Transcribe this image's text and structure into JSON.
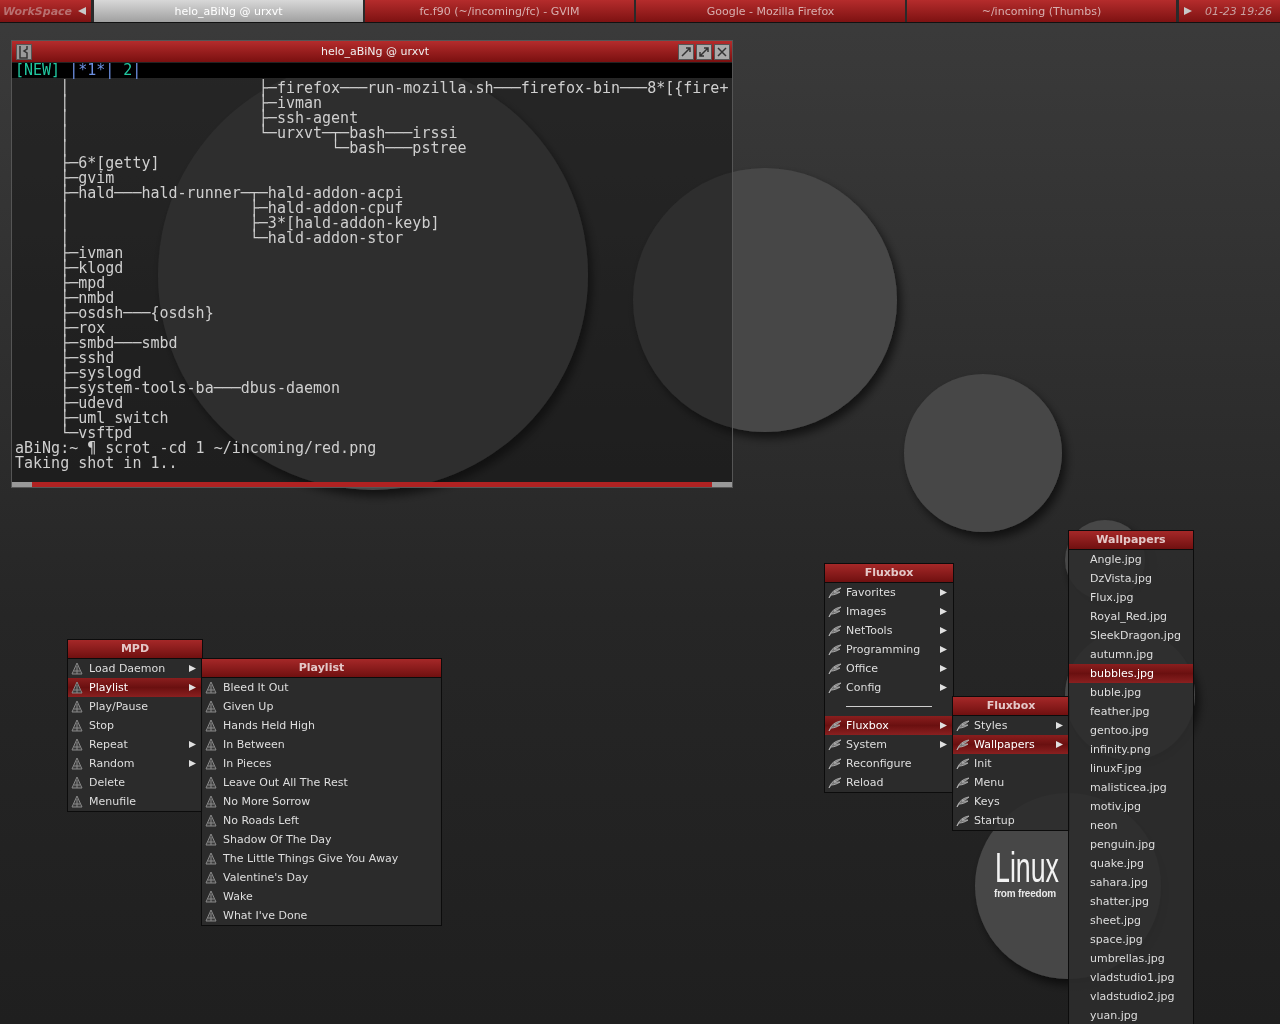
{
  "taskbar": {
    "items": [
      {
        "kind": "workspace",
        "label": "WorkSpace"
      },
      {
        "kind": "prev"
      },
      {
        "kind": "task",
        "label": "helo_aBiNg @ urxvt",
        "selected": true
      },
      {
        "kind": "task",
        "label": "fc.f90 (~/incoming/fc) - GVIM",
        "selected": false
      },
      {
        "kind": "task",
        "label": "Google - Mozilla Firefox",
        "selected": false
      },
      {
        "kind": "task",
        "label": "~/incoming (Thumbs)",
        "selected": false
      },
      {
        "kind": "next"
      },
      {
        "kind": "clock",
        "label": "01-23 19:26"
      }
    ]
  },
  "wallpaper_logo": {
    "word": "Linux",
    "tagline": "from freedom"
  },
  "terminal": {
    "title": "helo_aBiNg @ urxvt",
    "tabs": [
      {
        "kind": "new",
        "label": "[NEW]"
      },
      {
        "kind": "tab",
        "label": "|*1*|",
        "selected": true
      },
      {
        "kind": "tab",
        "label": "2",
        "selected": false
      },
      {
        "kind": "separator",
        "label": "|"
      }
    ],
    "lines": [
      "     │                     ├─firefox───run-mozilla.sh───firefox-bin───8*[{fire+",
      "     │                     ├─ivman",
      "     │                     ├─ssh-agent",
      "     │                     └─urxvt─┬─bash───irssi",
      "     │                             └─bash───pstree",
      "     ├─6*[getty]",
      "     ├─gvim",
      "     ├─hald───hald-runner─┬─hald-addon-acpi",
      "     │                    ├─hald-addon-cpuf",
      "     │                    ├─3*[hald-addon-keyb]",
      "     │                    └─hald-addon-stor",
      "     ├─ivman",
      "     ├─klogd",
      "     ├─mpd",
      "     ├─nmbd",
      "     ├─osdsh───{osdsh}",
      "     ├─rox",
      "     ├─smbd───smbd",
      "     ├─sshd",
      "     ├─syslogd",
      "     ├─system-tools-ba───dbus-daemon",
      "     ├─udevd",
      "     ├─uml_switch",
      "     └─vsftpd",
      "aBiNg:~ ¶ scrot -cd 1 ~/incoming/red.png",
      "Taking shot in 1.."
    ]
  },
  "menus": [
    {
      "kind": "mpd",
      "title": "MPD",
      "items": [
        {
          "label": "Load Daemon",
          "selected": false,
          "submenu": true
        },
        {
          "label": "Playlist",
          "selected": true,
          "submenu": true
        },
        {
          "label": "Play/Pause",
          "selected": false,
          "submenu": false
        },
        {
          "label": "Stop",
          "selected": false,
          "submenu": false
        },
        {
          "label": "Repeat",
          "selected": false,
          "submenu": true
        },
        {
          "label": "Random",
          "selected": false,
          "submenu": true
        },
        {
          "label": "Delete",
          "selected": false,
          "submenu": false
        },
        {
          "label": "Menufile",
          "selected": false,
          "submenu": false
        }
      ]
    },
    {
      "kind": "mpd",
      "title": "Playlist",
      "items": [
        {
          "label": "Bleed It Out",
          "selected": false,
          "submenu": false
        },
        {
          "label": "Given Up",
          "selected": false,
          "submenu": false
        },
        {
          "label": "Hands Held High",
          "selected": false,
          "submenu": false
        },
        {
          "label": "In Between",
          "selected": false,
          "submenu": false
        },
        {
          "label": "In Pieces",
          "selected": false,
          "submenu": false
        },
        {
          "label": "Leave Out All The Rest",
          "selected": false,
          "submenu": false
        },
        {
          "label": "No More Sorrow",
          "selected": false,
          "submenu": false
        },
        {
          "label": "No Roads Left",
          "selected": false,
          "submenu": false
        },
        {
          "label": "Shadow Of The Day",
          "selected": false,
          "submenu": false
        },
        {
          "label": "The Little Things Give You Away",
          "selected": false,
          "submenu": false
        },
        {
          "label": "Valentine's Day",
          "selected": false,
          "submenu": false
        },
        {
          "label": "Wake",
          "selected": false,
          "submenu": false
        },
        {
          "label": "What I've Done",
          "selected": false,
          "submenu": false
        }
      ]
    },
    {
      "kind": "fluxbox",
      "title": "Fluxbox",
      "items": [
        {
          "label": "Favorites",
          "selected": false,
          "submenu": true
        },
        {
          "label": "Images",
          "selected": false,
          "submenu": true
        },
        {
          "label": "NetTools",
          "selected": false,
          "submenu": true
        },
        {
          "label": "Programming",
          "selected": false,
          "submenu": true
        },
        {
          "label": "Office",
          "selected": false,
          "submenu": true
        },
        {
          "label": "Config",
          "selected": false,
          "submenu": true
        },
        {
          "kind": "separator"
        },
        {
          "label": "Fluxbox",
          "selected": true,
          "submenu": true
        },
        {
          "label": "System",
          "selected": false,
          "submenu": true
        },
        {
          "label": "Reconfigure",
          "selected": false,
          "submenu": false
        },
        {
          "label": "Reload",
          "selected": false,
          "submenu": false
        }
      ]
    },
    {
      "kind": "fluxbox",
      "title": "Fluxbox",
      "items": [
        {
          "label": "Styles",
          "selected": false,
          "submenu": true
        },
        {
          "label": "Wallpapers",
          "selected": true,
          "submenu": true
        },
        {
          "label": "Init",
          "selected": false,
          "submenu": false
        },
        {
          "label": "Menu",
          "selected": false,
          "submenu": false
        },
        {
          "label": "Keys",
          "selected": false,
          "submenu": false
        },
        {
          "label": "Startup",
          "selected": false,
          "submenu": false
        }
      ]
    },
    {
      "kind": "list",
      "title": "Wallpapers",
      "items": [
        {
          "label": "Angle.jpg",
          "selected": false,
          "submenu": false
        },
        {
          "label": "DzVista.jpg",
          "selected": false,
          "submenu": false
        },
        {
          "label": "Flux.jpg",
          "selected": false,
          "submenu": false
        },
        {
          "label": "Royal_Red.jpg",
          "selected": false,
          "submenu": false
        },
        {
          "label": "SleekDragon.jpg",
          "selected": false,
          "submenu": false
        },
        {
          "label": "autumn.jpg",
          "selected": false,
          "submenu": false
        },
        {
          "label": "bubbles.jpg",
          "selected": true,
          "submenu": false
        },
        {
          "label": "buble.jpg",
          "selected": false,
          "submenu": false
        },
        {
          "label": "feather.jpg",
          "selected": false,
          "submenu": false
        },
        {
          "label": "gentoo.jpg",
          "selected": false,
          "submenu": false
        },
        {
          "label": "infinity.png",
          "selected": false,
          "submenu": false
        },
        {
          "label": "linuxF.jpg",
          "selected": false,
          "submenu": false
        },
        {
          "label": "malisticea.jpg",
          "selected": false,
          "submenu": false
        },
        {
          "label": "motiv.jpg",
          "selected": false,
          "submenu": false
        },
        {
          "label": "neon",
          "selected": false,
          "submenu": false
        },
        {
          "label": "penguin.jpg",
          "selected": false,
          "submenu": false
        },
        {
          "label": "quake.jpg",
          "selected": false,
          "submenu": false
        },
        {
          "label": "sahara.jpg",
          "selected": false,
          "submenu": false
        },
        {
          "label": "shatter.jpg",
          "selected": false,
          "submenu": false
        },
        {
          "label": "sheet.jpg",
          "selected": false,
          "submenu": false
        },
        {
          "label": "space.jpg",
          "selected": false,
          "submenu": false
        },
        {
          "label": "umbrellas.jpg",
          "selected": false,
          "submenu": false
        },
        {
          "label": "vladstudio1.jpg",
          "selected": false,
          "submenu": false
        },
        {
          "label": "vladstudio2.jpg",
          "selected": false,
          "submenu": false
        },
        {
          "label": "yuan.jpg",
          "selected": false,
          "submenu": false
        }
      ]
    }
  ]
}
